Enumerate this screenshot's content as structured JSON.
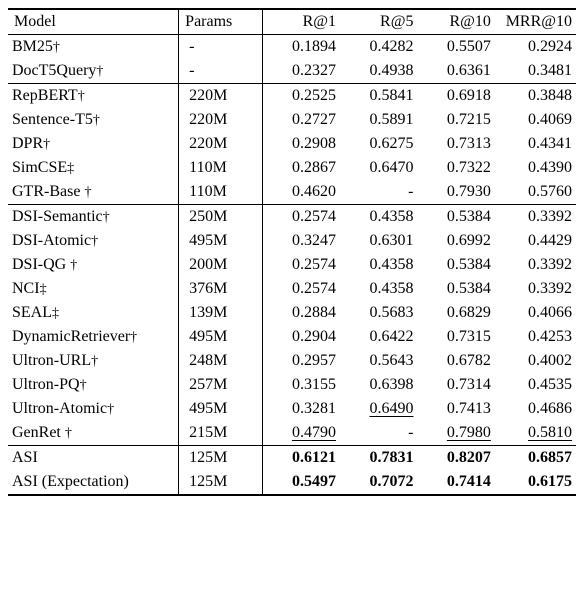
{
  "columns": {
    "model": "Model",
    "params": "Params",
    "r1": "R@1",
    "r5": "R@5",
    "r10": "R@10",
    "mrr10": "MRR@10"
  },
  "groups": [
    {
      "rows": [
        {
          "model": "BM25",
          "mark": "dagger",
          "params": "-",
          "r1": "0.1894",
          "r5": "0.4282",
          "r10": "0.5507",
          "mrr10": "0.2924"
        },
        {
          "model": "DocT5Query",
          "mark": "dagger",
          "params": "-",
          "r1": "0.2327",
          "r5": "0.4938",
          "r10": "0.6361",
          "mrr10": "0.3481"
        }
      ]
    },
    {
      "rows": [
        {
          "model": "RepBERT",
          "mark": "dagger",
          "params": "220M",
          "r1": "0.2525",
          "r5": "0.5841",
          "r10": "0.6918",
          "mrr10": "0.3848"
        },
        {
          "model": "Sentence-T5",
          "mark": "dagger",
          "params": "220M",
          "r1": "0.2727",
          "r5": "0.5891",
          "r10": "0.7215",
          "mrr10": "0.4069"
        },
        {
          "model": "DPR",
          "mark": "dagger",
          "params": "220M",
          "r1": "0.2908",
          "r5": "0.6275",
          "r10": "0.7313",
          "mrr10": "0.4341"
        },
        {
          "model": "SimCSE",
          "mark": "ddagger",
          "params": "110M",
          "r1": "0.2867",
          "r5": "0.6470",
          "r10": "0.7322",
          "mrr10": "0.4390"
        },
        {
          "model": "GTR-Base ",
          "mark": "dagger",
          "params": "110M",
          "r1": "0.4620",
          "r5": "-",
          "r10": "0.7930",
          "mrr10": "0.5760"
        }
      ]
    },
    {
      "rows": [
        {
          "model": "DSI-Semantic",
          "mark": "dagger",
          "params": "250M",
          "r1": "0.2574",
          "r5": "0.4358",
          "r10": "0.5384",
          "mrr10": "0.3392"
        },
        {
          "model": "DSI-Atomic",
          "mark": "dagger",
          "params": "495M",
          "r1": "0.3247",
          "r5": "0.6301",
          "r10": "0.6992",
          "mrr10": "0.4429"
        },
        {
          "model": "DSI-QG ",
          "mark": "dagger",
          "params": "200M",
          "r1": "0.2574",
          "r5": "0.4358",
          "r10": "0.5384",
          "mrr10": "0.3392"
        },
        {
          "model": "NCI",
          "mark": "ddagger",
          "params": "376M",
          "r1": "0.2574",
          "r5": "0.4358",
          "r10": "0.5384",
          "mrr10": "0.3392"
        },
        {
          "model": "SEAL",
          "mark": "ddagger",
          "params": "139M",
          "r1": "0.2884",
          "r5": "0.5683",
          "r10": "0.6829",
          "mrr10": "0.4066"
        },
        {
          "model": "DynamicRetriever",
          "mark": "dagger",
          "params": "495M",
          "r1": "0.2904",
          "r5": "0.6422",
          "r10": "0.7315",
          "mrr10": "0.4253"
        },
        {
          "model": "Ultron-URL",
          "mark": "dagger",
          "params": "248M",
          "r1": "0.2957",
          "r5": "0.5643",
          "r10": "0.6782",
          "mrr10": "0.4002"
        },
        {
          "model": "Ultron-PQ",
          "mark": "dagger",
          "params": "257M",
          "r1": "0.3155",
          "r5": "0.6398",
          "r10": "0.7314",
          "mrr10": "0.4535"
        },
        {
          "model": "Ultron-Atomic",
          "mark": "dagger",
          "params": "495M",
          "r1": "0.3281",
          "r5": "0.6490",
          "r5_uline": true,
          "r10": "0.7413",
          "mrr10": "0.4686"
        },
        {
          "model": "GenRet ",
          "mark": "dagger",
          "params": "215M",
          "r1": "0.4790",
          "r1_uline": true,
          "r5": "-",
          "r10": "0.7980",
          "r10_uline": true,
          "mrr10": "0.5810",
          "mrr10_uline": true
        }
      ]
    },
    {
      "rows": [
        {
          "model": "ASI",
          "mark": "",
          "params": "125M",
          "r1": "0.6121",
          "r5": "0.7831",
          "r10": "0.8207",
          "mrr10": "0.6857",
          "bold": true
        },
        {
          "model": "ASI (Expectation)",
          "mark": "",
          "params": "125M",
          "r1": "0.5497",
          "r5": "0.7072",
          "r10": "0.7414",
          "mrr10": "0.6175",
          "bold": true
        }
      ]
    }
  ],
  "chart_data": {
    "type": "table",
    "title": "",
    "columns": [
      "Model",
      "Params",
      "R@1",
      "R@5",
      "R@10",
      "MRR@10"
    ],
    "rows": [
      [
        "BM25†",
        "-",
        0.1894,
        0.4282,
        0.5507,
        0.2924
      ],
      [
        "DocT5Query†",
        "-",
        0.2327,
        0.4938,
        0.6361,
        0.3481
      ],
      [
        "RepBERT†",
        "220M",
        0.2525,
        0.5841,
        0.6918,
        0.3848
      ],
      [
        "Sentence-T5†",
        "220M",
        0.2727,
        0.5891,
        0.7215,
        0.4069
      ],
      [
        "DPR†",
        "220M",
        0.2908,
        0.6275,
        0.7313,
        0.4341
      ],
      [
        "SimCSE‡",
        "110M",
        0.2867,
        0.647,
        0.7322,
        0.439
      ],
      [
        "GTR-Base †",
        "110M",
        0.462,
        null,
        0.793,
        0.576
      ],
      [
        "DSI-Semantic†",
        "250M",
        0.2574,
        0.4358,
        0.5384,
        0.3392
      ],
      [
        "DSI-Atomic†",
        "495M",
        0.3247,
        0.6301,
        0.6992,
        0.4429
      ],
      [
        "DSI-QG †",
        "200M",
        0.2574,
        0.4358,
        0.5384,
        0.3392
      ],
      [
        "NCI‡",
        "376M",
        0.2574,
        0.4358,
        0.5384,
        0.3392
      ],
      [
        "SEAL‡",
        "139M",
        0.2884,
        0.5683,
        0.6829,
        0.4066
      ],
      [
        "DynamicRetriever†",
        "495M",
        0.2904,
        0.6422,
        0.7315,
        0.4253
      ],
      [
        "Ultron-URL†",
        "248M",
        0.2957,
        0.5643,
        0.6782,
        0.4002
      ],
      [
        "Ultron-PQ†",
        "257M",
        0.3155,
        0.6398,
        0.7314,
        0.4535
      ],
      [
        "Ultron-Atomic†",
        "495M",
        0.3281,
        0.649,
        0.7413,
        0.4686
      ],
      [
        "GenRet †",
        "215M",
        0.479,
        null,
        0.798,
        0.581
      ],
      [
        "ASI",
        "125M",
        0.6121,
        0.7831,
        0.8207,
        0.6857
      ],
      [
        "ASI (Expectation)",
        "125M",
        0.5497,
        0.7072,
        0.7414,
        0.6175
      ]
    ]
  }
}
